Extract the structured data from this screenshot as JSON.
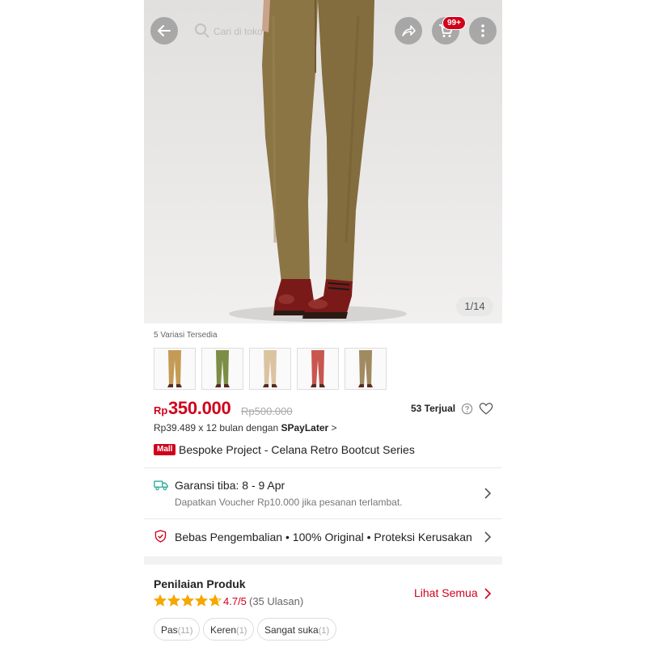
{
  "header": {
    "search_placeholder": "Cari di toko",
    "cart_badge": "99+"
  },
  "gallery": {
    "counter": "1/14"
  },
  "variants": {
    "label": "5 Variasi Tersedia",
    "items": [
      {
        "name": "Mustard",
        "color": "#c49a55"
      },
      {
        "name": "Olive Green",
        "color": "#7c8d45"
      },
      {
        "name": "Cream",
        "color": "#dcc3a0"
      },
      {
        "name": "Red",
        "color": "#c8564f"
      },
      {
        "name": "Khaki",
        "color": "#a08a60"
      }
    ]
  },
  "price": {
    "currency": "Rp",
    "current": "350.000",
    "original": "Rp500.000",
    "sold": "53 Terjual",
    "installment_prefix": "Rp39.489 x 12 bulan dengan",
    "installment_brand": "SPayLater",
    "installment_suffix": ">"
  },
  "product": {
    "mall_badge": "Mall",
    "title": "Bespoke Project - Celana Retro Bootcut Series"
  },
  "shipping": {
    "title": "Garansi tiba: 8 - 9 Apr",
    "subtitle": "Dapatkan Voucher Rp10.000 jika pesanan terlambat."
  },
  "guarantee": {
    "text": "Bebas Pengembalian  •  100% Original  •  Proteksi Kerusakan"
  },
  "ratings": {
    "title": "Penilaian Produk",
    "score": "4.7/5",
    "count": "(35 Ulasan)",
    "see_all": "Lihat Semua",
    "stars": 4.7,
    "tags": [
      {
        "label": "Pas",
        "count": "(11)"
      },
      {
        "label": "Keren",
        "count": "(1)"
      },
      {
        "label": "Sangat suka",
        "count": "(1)"
      }
    ]
  },
  "colors": {
    "accent": "#d0011b",
    "pants": "#8c7545",
    "boots": "#7a1a18"
  }
}
